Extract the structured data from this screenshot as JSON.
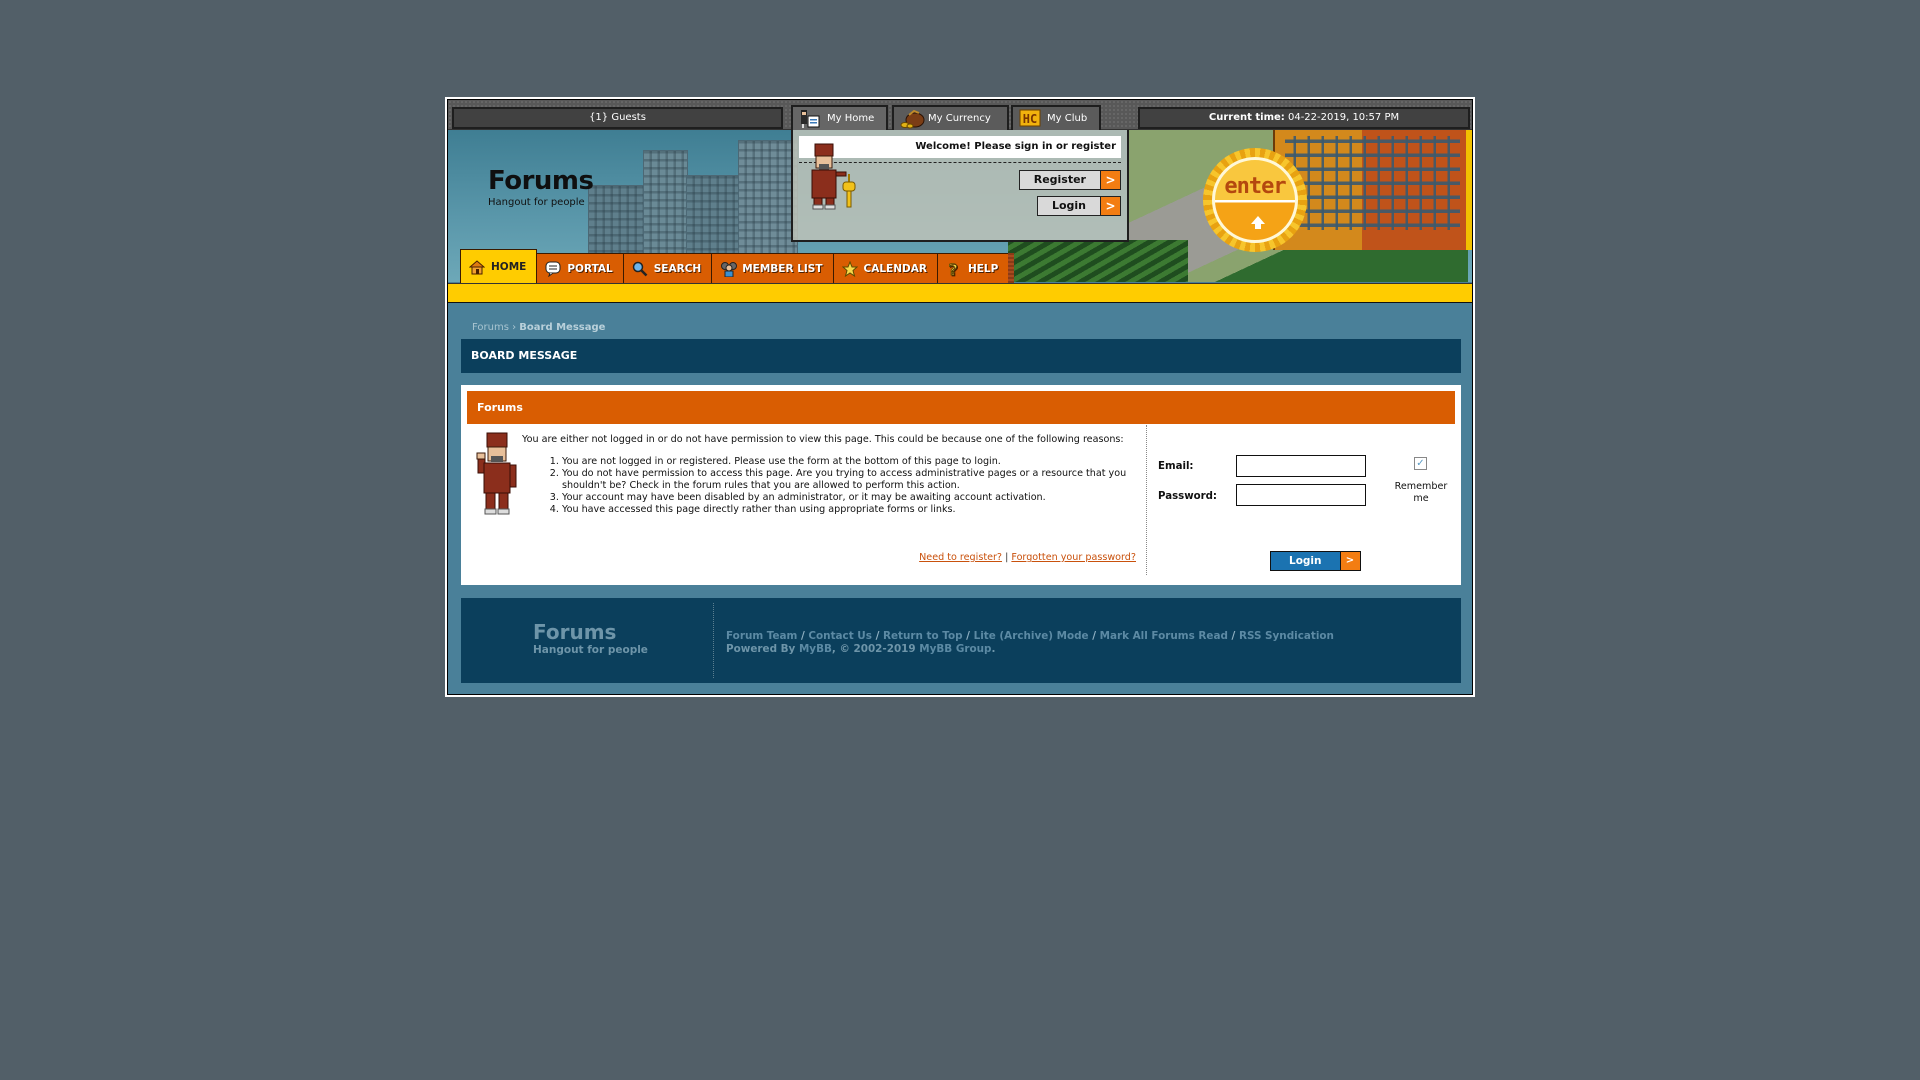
{
  "topbar": {
    "guests": "{1} Guests",
    "tabs": [
      {
        "label": "My Home",
        "icon": "user-home-icon"
      },
      {
        "label": "My Currency",
        "icon": "coin-bag-icon"
      },
      {
        "label": "My Club",
        "icon": "hc-club-icon"
      }
    ],
    "time_label": "Current time:",
    "time_value": "04-22-2019, 10:57 PM"
  },
  "header": {
    "title": "Forums",
    "subtitle": "Hangout for people",
    "welcome": "Welcome! Please sign in or register",
    "register_label": "Register",
    "login_label": "Login",
    "arrow": ">",
    "enter_badge": "enter"
  },
  "nav": [
    {
      "label": "HOME",
      "icon": "house-icon",
      "active": true
    },
    {
      "label": "PORTAL",
      "icon": "speech-bubble-icon"
    },
    {
      "label": "SEARCH",
      "icon": "magnifier-icon"
    },
    {
      "label": "MEMBER LIST",
      "icon": "members-icon"
    },
    {
      "label": "CALENDAR",
      "icon": "star-icon"
    },
    {
      "label": "HELP",
      "icon": "question-icon"
    }
  ],
  "breadcrumb": {
    "root": "Forums",
    "separator": "›",
    "current": "Board Message"
  },
  "board_message": {
    "heading": "BOARD MESSAGE",
    "panel_title": "Forums",
    "intro": "You are either not logged in or do not have permission to view this page. This could be because one of the following reasons:",
    "reasons": [
      "You are not logged in or registered. Please use the form at the bottom of this page to login.",
      "You do not have permission to access this page. Are you trying to access administrative pages or a resource that you shouldn't be? Check in the forum rules that you are allowed to perform this action.",
      "Your account may have been disabled by an administrator, or it may be awaiting account activation.",
      "You have accessed this page directly rather than using appropriate forms or links."
    ],
    "need_register": "Need to register?",
    "link_sep": "|",
    "forgot_password": "Forgotten your password?"
  },
  "login_form": {
    "email_label": "Email:",
    "email_value": "",
    "password_label": "Password:",
    "password_value": "",
    "remember_label": "Remember me",
    "remember_checked": true,
    "submit_label": "Login",
    "submit_arrow": ">"
  },
  "footer": {
    "title": "Forums",
    "subtitle": "Hangout for people",
    "links": [
      "Forum Team",
      "Contact Us",
      "Return to Top",
      "Lite (Archive) Mode",
      "Mark All Forums Read",
      "RSS Syndication"
    ],
    "link_sep": "/",
    "powered_prefix": "Powered By",
    "powered_link": "MyBB",
    "copyright_mid": ", © 2002-2019",
    "copyright_link": "MyBB Group",
    "copyright_end": "."
  },
  "colors": {
    "background": "#525f68",
    "frame_blue": "#4a8099",
    "dark_blue": "#0b3f5c",
    "orange": "#d95d02",
    "yellow": "#ffcc00",
    "button_orange": "#f37d12",
    "login_blue": "#1b73b1"
  }
}
